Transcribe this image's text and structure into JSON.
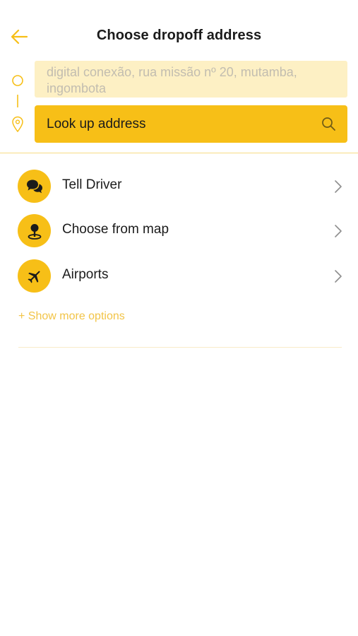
{
  "header": {
    "title": "Choose dropoff address",
    "back_icon": "arrow-left-icon"
  },
  "route": {
    "pickup_address": "digital conexão, rua missão nº 20, mutamba, ingombota",
    "dropoff_placeholder": "Look up address",
    "origin_icon": "circle-icon",
    "destination_icon": "location-pin-icon"
  },
  "options": [
    {
      "label": "Tell Driver",
      "icon": "chat-bubbles-icon"
    },
    {
      "label": "Choose from map",
      "icon": "map-pin-icon"
    },
    {
      "label": "Airports",
      "icon": "airplane-icon"
    }
  ],
  "show_more_label": "+ Show more options",
  "colors": {
    "accent": "#f7bf17",
    "accent_light": "#fdf0c4",
    "text": "#1b1b1b",
    "muted_text": "#c2bdb0",
    "link": "#f2c447",
    "chevron": "#8e8e8e"
  }
}
